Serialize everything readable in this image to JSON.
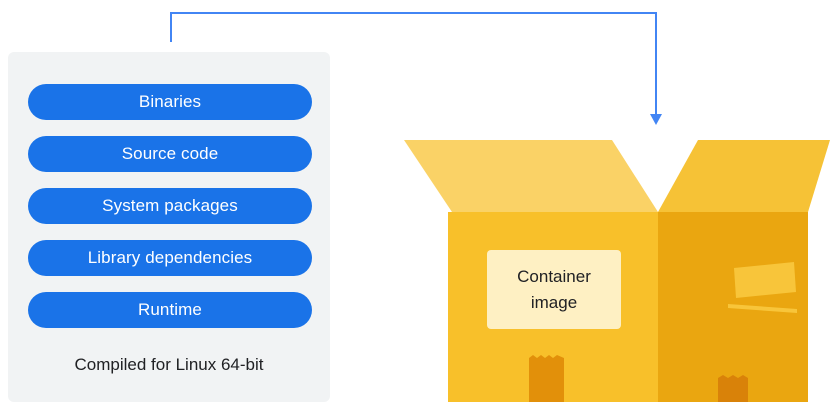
{
  "components": [
    {
      "label": "Binaries"
    },
    {
      "label": "Source code"
    },
    {
      "label": "System packages"
    },
    {
      "label": "Library dependencies"
    },
    {
      "label": "Runtime"
    }
  ],
  "compiled_note": "Compiled for Linux 64-bit",
  "box_label": {
    "line1": "Container",
    "line2": "image"
  },
  "colors": {
    "pill": "#1a73e8",
    "panel": "#f1f3f4",
    "arrow": "#4285f4",
    "box_front": "#f8c02a",
    "box_side": "#eaa610",
    "flap": "#fad266",
    "label_card": "#fef0c3",
    "tape": "#e2900a"
  }
}
